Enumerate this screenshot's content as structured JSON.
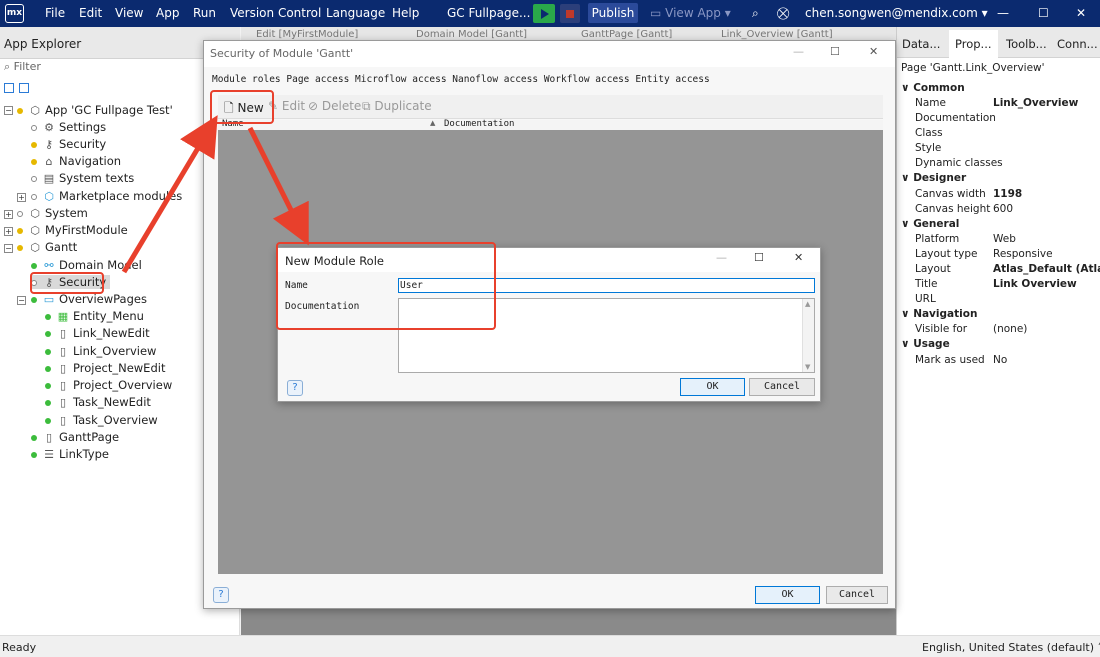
{
  "titlebar": {
    "menus": [
      "File",
      "Edit",
      "View",
      "App",
      "Run",
      "Version Control",
      "Language",
      "Help"
    ],
    "project": "GC Fullpage...",
    "publish": "Publish",
    "view_app": "View App",
    "user": "chen.songwen@mendix.com",
    "logo": "mx"
  },
  "left": {
    "title": "App Explorer",
    "filter": "Filter",
    "items": [
      {
        "label": "App 'GC Fullpage Test'"
      },
      {
        "label": "Settings"
      },
      {
        "label": "Security"
      },
      {
        "label": "Navigation"
      },
      {
        "label": "System texts"
      },
      {
        "label": "Marketplace modules"
      },
      {
        "label": "System"
      },
      {
        "label": "MyFirstModule"
      },
      {
        "label": "Gantt"
      },
      {
        "label": "Domain Model"
      },
      {
        "label": "Security"
      },
      {
        "label": "OverviewPages"
      },
      {
        "label": "Entity_Menu"
      },
      {
        "label": "Link_NewEdit"
      },
      {
        "label": "Link_Overview"
      },
      {
        "label": "Project_NewEdit"
      },
      {
        "label": "Project_Overview"
      },
      {
        "label": "Task_NewEdit"
      },
      {
        "label": "Task_Overview"
      },
      {
        "label": "GanttPage"
      },
      {
        "label": "LinkType"
      }
    ]
  },
  "editor_tabs": [
    "Edit [MyFirstModule]",
    "Domain Model [Gantt]",
    "GanttPage [Gantt]",
    "Link_Overview [Gantt]"
  ],
  "security_dialog": {
    "title": "Security of Module 'Gantt'",
    "tabs": [
      "Module roles",
      "Page access",
      "Microflow access",
      "Nanoflow access",
      "Workflow access",
      "Entity access"
    ],
    "toolbar": {
      "new": "New",
      "edit": "Edit",
      "delete": "Delete",
      "duplicate": "Duplicate"
    },
    "columns": [
      "Name",
      "Documentation"
    ],
    "ok": "OK",
    "cancel": "Cancel",
    "help": "?"
  },
  "role_dialog": {
    "title": "New Module Role",
    "name_label": "Name",
    "name_value": "User",
    "doc_label": "Documentation",
    "doc_value": "",
    "ok": "OK",
    "cancel": "Cancel",
    "help": "?"
  },
  "right": {
    "tabs": [
      "Data...",
      "Prop...",
      "Toolb...",
      "Conn..."
    ],
    "page": "Page 'Gantt.Link_Overview'",
    "sections": [
      {
        "title": "Common",
        "rows": [
          [
            "Name",
            "Link_Overview"
          ],
          [
            "Documentation",
            ""
          ],
          [
            "Class",
            ""
          ],
          [
            "Style",
            ""
          ],
          [
            "Dynamic classes",
            ""
          ]
        ]
      },
      {
        "title": "Designer",
        "rows": [
          [
            "Canvas width",
            "1198"
          ],
          [
            "Canvas height",
            "600"
          ]
        ]
      },
      {
        "title": "General",
        "rows": [
          [
            "Platform",
            "Web"
          ],
          [
            "Layout type",
            "Responsive"
          ],
          [
            "Layout",
            "Atlas_Default (Atlas_C"
          ],
          [
            "Title",
            "Link Overview"
          ],
          [
            "URL",
            ""
          ]
        ]
      },
      {
        "title": "Navigation",
        "rows": [
          [
            "Visible for",
            "(none)"
          ]
        ]
      },
      {
        "title": "Usage",
        "rows": [
          [
            "Mark as used",
            "No"
          ]
        ]
      }
    ]
  },
  "status": {
    "left": "Ready",
    "right": "English, United States (default)"
  },
  "colors": {
    "titlebar": "#0b2a6f",
    "annotation": "#e8402c",
    "run": "#2aa84a"
  }
}
